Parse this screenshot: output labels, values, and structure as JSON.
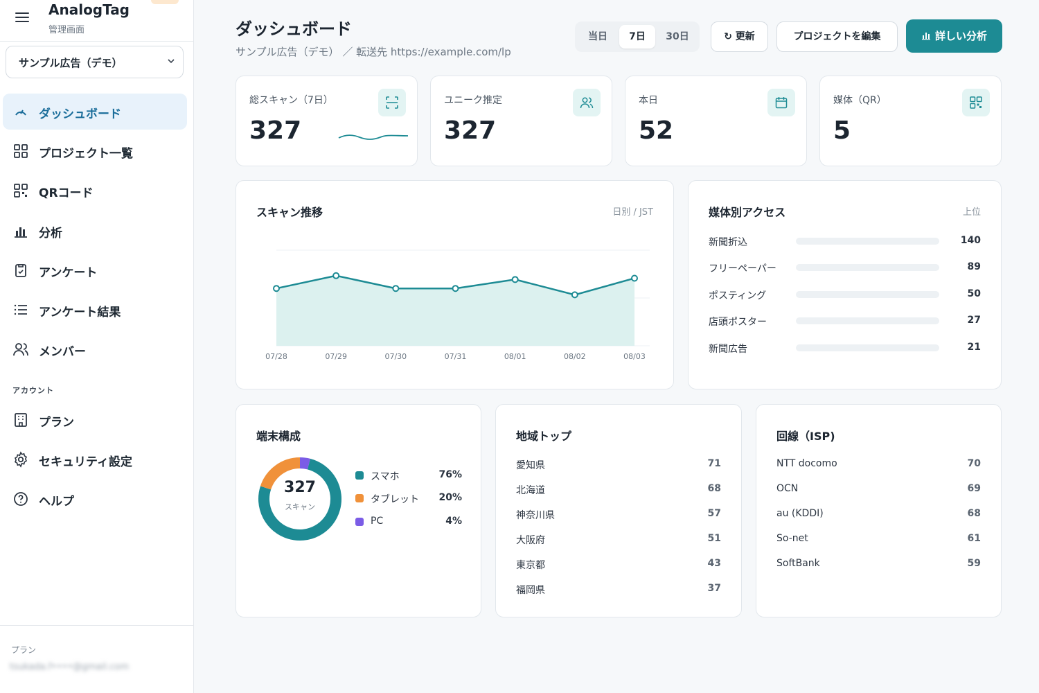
{
  "brand": {
    "name": "AnalogTag",
    "subtitle": "管理画面"
  },
  "project_select": {
    "value": "サンプル広告（デモ）"
  },
  "nav": {
    "items": [
      {
        "label": "ダッシュボード"
      },
      {
        "label": "プロジェクト一覧"
      },
      {
        "label": "QRコード"
      },
      {
        "label": "分析"
      },
      {
        "label": "アンケート"
      },
      {
        "label": "アンケート結果"
      },
      {
        "label": "メンバー"
      }
    ],
    "account_section": "アカウント",
    "account_items": [
      {
        "label": "プラン"
      },
      {
        "label": "セキュリティ設定"
      },
      {
        "label": "ヘルプ"
      }
    ]
  },
  "footer": {
    "plan_label": "プラン",
    "email": "tsukada.f••••@gmail.com"
  },
  "header": {
    "title": "ダッシュボード",
    "breadcrumb": "サンプル広告（デモ） ／ 転送先 https://example.com/lp",
    "ranges": [
      "当日",
      "7日",
      "30日"
    ],
    "selected_range": "7日",
    "refresh_label": "↻ 更新",
    "edit_label": "プロジェクトを編集",
    "detail_label": "詳しい分析"
  },
  "kpis": [
    {
      "label": "総スキャン（7日）",
      "value": "327",
      "icon": "scan-icon"
    },
    {
      "label": "ユニーク推定",
      "value": "327",
      "icon": "users-icon"
    },
    {
      "label": "本日",
      "value": "52",
      "icon": "calendar-icon"
    },
    {
      "label": "媒体（QR）",
      "value": "5",
      "icon": "qr-grid-icon"
    }
  ],
  "scan_trend": {
    "title": "スキャン推移",
    "hint": "日別 / JST"
  },
  "chart_data": {
    "type": "area",
    "categories": [
      "07/28",
      "07/29",
      "07/30",
      "07/31",
      "08/01",
      "08/02",
      "08/03"
    ],
    "values": [
      45,
      55,
      45,
      45,
      52,
      40,
      53
    ],
    "ylim": [
      0,
      75
    ],
    "grid": true,
    "color": "#1d8b94"
  },
  "media": {
    "title": "媒体別アクセス",
    "hint": "上位",
    "rows": [
      {
        "label": "新聞折込",
        "value": "140"
      },
      {
        "label": "フリーペーパー",
        "value": "89"
      },
      {
        "label": "ポスティング",
        "value": "50"
      },
      {
        "label": "店頭ポスター",
        "value": "27"
      },
      {
        "label": "新聞広告",
        "value": "21"
      }
    ]
  },
  "devices": {
    "title": "端末構成",
    "total": "327",
    "total_label": "スキャン",
    "items": [
      {
        "label": "スマホ",
        "pct": "76%",
        "share": 76,
        "color": "#1d8b94"
      },
      {
        "label": "タブレット",
        "pct": "20%",
        "share": 20,
        "color": "#f0913a"
      },
      {
        "label": "PC",
        "pct": "4%",
        "share": 4,
        "color": "#7b5ce6"
      }
    ]
  },
  "regions": {
    "title": "地域トップ",
    "rows": [
      {
        "label": "愛知県",
        "value": "71"
      },
      {
        "label": "北海道",
        "value": "68"
      },
      {
        "label": "神奈川県",
        "value": "57"
      },
      {
        "label": "大阪府",
        "value": "51"
      },
      {
        "label": "東京都",
        "value": "43"
      },
      {
        "label": "福岡県",
        "value": "37"
      }
    ]
  },
  "isp": {
    "title": "回線（ISP)",
    "rows": [
      {
        "label": "NTT docomo",
        "value": "70"
      },
      {
        "label": "OCN",
        "value": "69"
      },
      {
        "label": "au (KDDI)",
        "value": "68"
      },
      {
        "label": "So-net",
        "value": "61"
      },
      {
        "label": "SoftBank",
        "value": "59"
      }
    ]
  }
}
